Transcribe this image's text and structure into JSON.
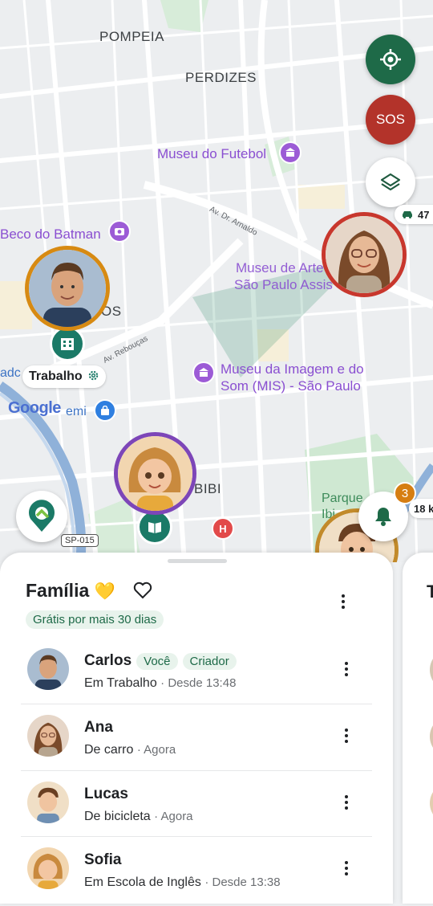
{
  "map": {
    "area_labels": [
      "POMPEIA",
      "PERDIZES",
      "BIBI"
    ],
    "poi_labels": {
      "museu_futebol": "Museu do Futebol",
      "beco_batman": "Beco do Batman",
      "museu_arte_l1": "Museu de Arte",
      "museu_arte_l2": "São Paulo Assis",
      "mis_l1": "Museu da Imagem e do",
      "mis_l2": "Som (MIS) - São Paulo",
      "parque_l1": "Parque",
      "parque_l2": "Ibi",
      "adc": "adc",
      "emi": "emi"
    },
    "streets": [
      "Av. Dr. Arnaldo",
      "Av. Rebouças"
    ],
    "road_shield": "SP-015",
    "google_logo": "Google",
    "place_tag": "Trabalho",
    "car_distance": "47",
    "bike_distance": "18 k",
    "notification_count": "3",
    "sos_label": "SOS",
    "accent_green": "#1e6a48",
    "sos_red": "#b3332a"
  },
  "sheet": {
    "title": "Família",
    "title_emoji": "💛",
    "trial_badge": "Grátis por mais 30 dias",
    "members": [
      {
        "name": "Carlos",
        "tags": [
          "Você",
          "Criador"
        ],
        "status": "Em Trabalho",
        "time": "Desde 13:48"
      },
      {
        "name": "Ana",
        "tags": [],
        "status": "De carro",
        "time": "Agora"
      },
      {
        "name": "Lucas",
        "tags": [],
        "status": "De bicicleta",
        "time": "Agora"
      },
      {
        "name": "Sofia",
        "tags": [],
        "status": "Em Escola de Inglês",
        "time": "Desde 13:38"
      }
    ],
    "next_sheet_initial": "T"
  }
}
